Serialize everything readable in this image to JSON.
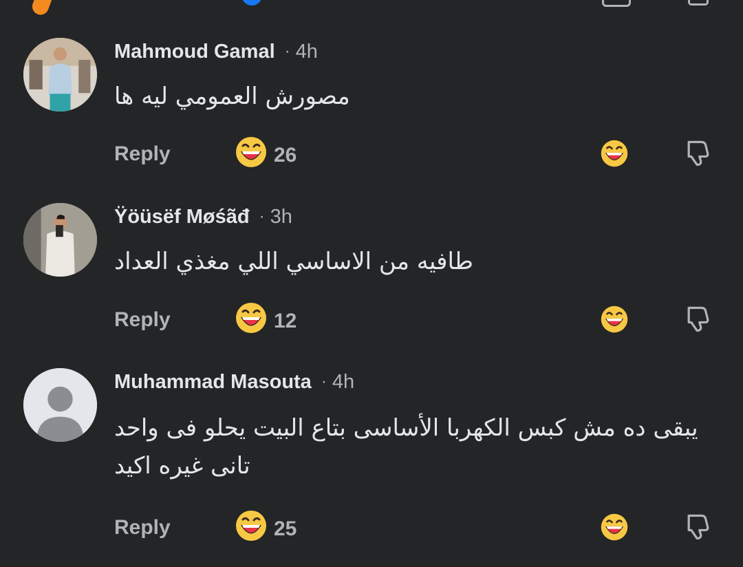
{
  "comments": [
    {
      "author": "Mahmoud Gamal",
      "separator": "·",
      "time": "4h",
      "text": "مصورش العمومي ليه ها",
      "reply_label": "Reply",
      "reaction_count": "26",
      "reaction_icon": "laughing-emoji-icon"
    },
    {
      "author": "Ÿöüsëf Møśãđ",
      "separator": "·",
      "time": "3h",
      "text": "طافيه من الاساسي اللي مغذي العداد",
      "reply_label": "Reply",
      "reaction_count": "12",
      "reaction_icon": "laughing-emoji-icon"
    },
    {
      "author": "Muhammad Masouta",
      "separator": "·",
      "time": "4h",
      "text": "يبقى ده مش كبس الكهربا الأساسى بتاع البيت يحلو فى واحد تانى غيره اكيد",
      "reply_label": "Reply",
      "reaction_count": "25",
      "reaction_icon": "laughing-emoji-icon"
    }
  ],
  "colors": {
    "background": "#242526",
    "primary_text": "#e4e6eb",
    "secondary_text": "#b0b3b8",
    "emoji_yellow": "#f7c844",
    "emoji_mouth": "#e8334a"
  }
}
